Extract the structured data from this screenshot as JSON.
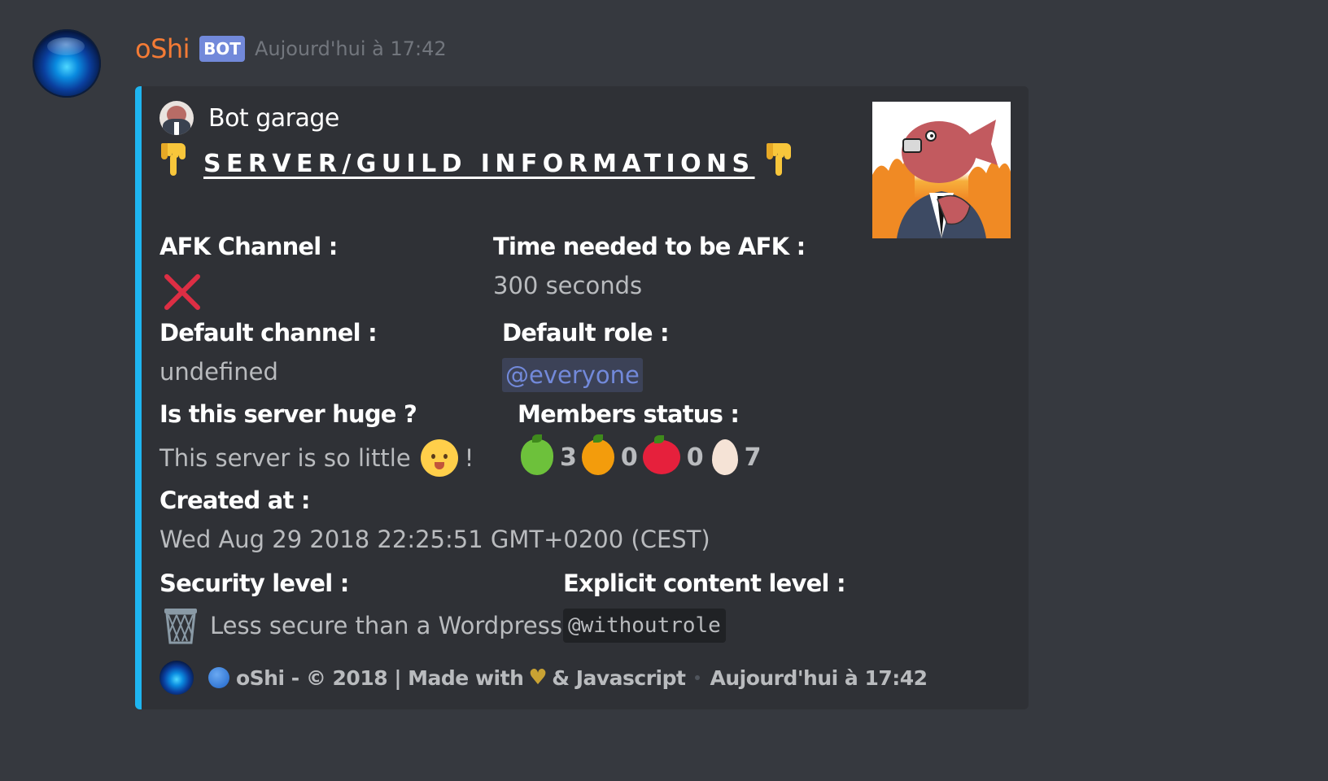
{
  "message": {
    "username": "oShi",
    "bot_tag": "BOT",
    "timestamp": "Aujourd'hui à 17:42"
  },
  "embed": {
    "accent_color": "#1eb5f0",
    "author_name": "Bot garage",
    "title": "SERVER/GUILD INFORMATIONS",
    "title_icon": "pointing-down-hand-icon",
    "fields": {
      "afk_channel": {
        "name": "AFK Channel :",
        "value_icon": "cross-mark-icon"
      },
      "afk_timeout": {
        "name": "Time needed to be AFK :",
        "value": "300 seconds"
      },
      "default_channel": {
        "name": "Default channel :",
        "value": "undefined"
      },
      "default_role": {
        "name": "Default role :",
        "value": "@everyone"
      },
      "server_huge": {
        "name": "Is this server huge ?",
        "value": "This server is so little",
        "value_suffix": "!",
        "emoji": "baby-face-icon"
      },
      "members_status": {
        "name": "Members status :",
        "items": [
          {
            "icon": "green-apple-icon",
            "count": "3"
          },
          {
            "icon": "orange-icon",
            "count": "0"
          },
          {
            "icon": "tomato-icon",
            "count": "0"
          },
          {
            "icon": "egg-icon",
            "count": "7"
          }
        ]
      },
      "created_at": {
        "name": "Created at :",
        "value": "Wed Aug 29 2018 22:25:51 GMT+0200 (CEST)"
      },
      "security_level": {
        "name": "Security level :",
        "value": "Less secure than a Wordpress",
        "emoji": "wastebasket-icon"
      },
      "explicit_content": {
        "name": "Explicit content level :",
        "value": "@withoutrole"
      }
    },
    "footer": {
      "text_part1": "oShi - © 2018 | Made with",
      "text_part2": "& Javascript",
      "timestamp": "Aujourd'hui à 17:42"
    }
  }
}
